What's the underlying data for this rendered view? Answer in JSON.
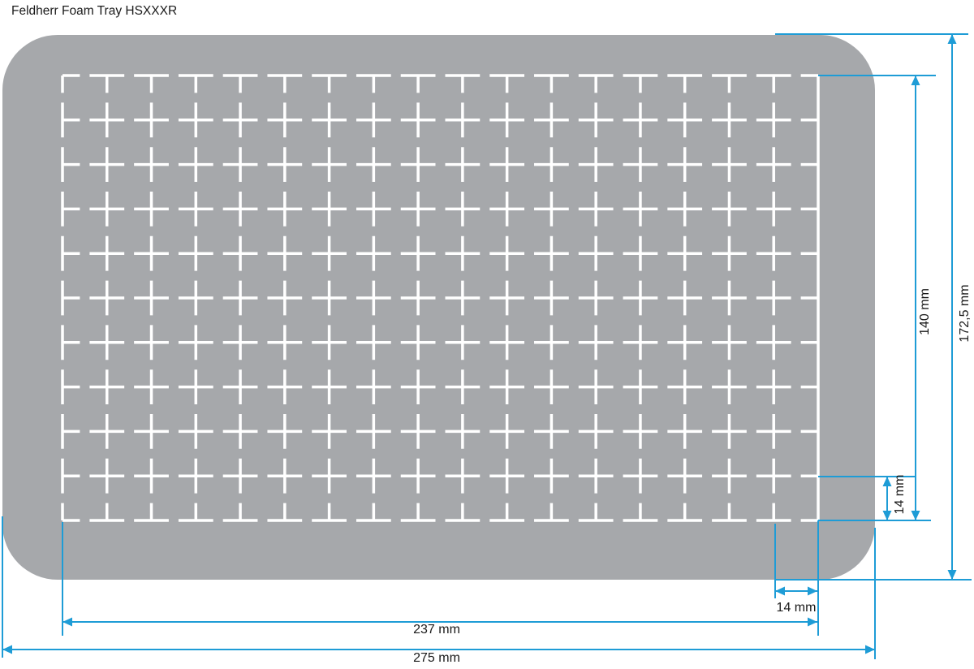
{
  "title": "Feldherr Foam Tray HSXXXR",
  "tray": {
    "type": "pick-and-pluck foam tray",
    "grid": {
      "columns": 17,
      "rows": 10,
      "cell_label": "14 mm"
    }
  },
  "dimensions": {
    "grid_width_label": "237 mm",
    "total_width_label": "275 mm",
    "grid_height_label": "140 mm",
    "total_height_label": "172,5 mm",
    "cell_width_label": "14 mm",
    "cell_height_label": "14 mm"
  },
  "colors": {
    "tray_fill": "#a6a8ab",
    "grid_lines": "#ffffff",
    "dimension_lines": "#1e9cd6",
    "text": "#1a1a1a",
    "background": "#ffffff"
  }
}
